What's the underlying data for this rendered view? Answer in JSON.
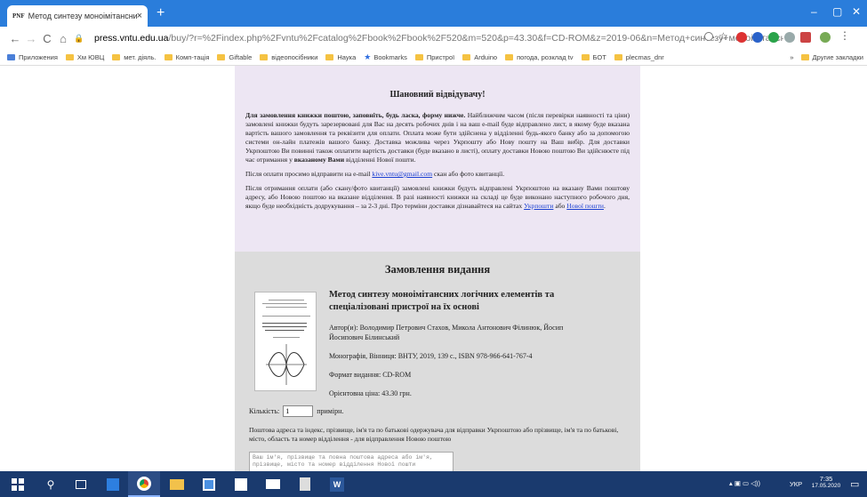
{
  "browser": {
    "tab_favicon": "PNF",
    "tab_title": "Метод синтезу моноімітансних",
    "tab_close": "×",
    "new_tab": "+",
    "minimize": "–",
    "restore": "▢",
    "close": "✕"
  },
  "address": {
    "host": "press.vntu.edu.ua",
    "path": "/buy/?r=%2Findex.php%2Fvntu%2Fcatalog%2Fbook%2Fbook%2F520&m=520&p=43.30&f=CD-ROM&z=2019-06&n=Метод+синтезу+моноімітансних+ло..."
  },
  "bookmarks": {
    "items": [
      {
        "label": "Приложения",
        "icon": "apps-icon"
      },
      {
        "label": "Хм ЮВЦ",
        "icon": "folder-icon"
      },
      {
        "label": "мет. діяль.",
        "icon": "folder-icon"
      },
      {
        "label": "Комп-тація",
        "icon": "folder-icon"
      },
      {
        "label": "Giftable",
        "icon": "folder-icon"
      },
      {
        "label": "відеопосібники",
        "icon": "folder-icon"
      },
      {
        "label": "Наука",
        "icon": "folder-icon"
      },
      {
        "label": "Bookmarks",
        "icon": "star-icon"
      },
      {
        "label": "Пристрої",
        "icon": "folder-icon"
      },
      {
        "label": "Arduino",
        "icon": "folder-icon"
      },
      {
        "label": "погода, розклад tv",
        "icon": "folder-icon"
      },
      {
        "label": "БОТ",
        "icon": "folder-icon"
      },
      {
        "label": "plecmas_dnr",
        "icon": "folder-icon"
      }
    ],
    "more": "»",
    "other": "Другие закладки"
  },
  "notice": {
    "heading": "Шановний відвідувачу!",
    "p1_bold": "Для замовлення книжки поштою, заповніть, будь ласка, форму нижче.",
    "p1_text": " Найближчим часом (після перевірки наявності та ціни) замовлені книжки будуть зарезервовані для Вас на десять робочих днів і на ваш e-mail буде відправлено лист, в якому буде вказана вартість вашого замовлення та реквізити для оплати. Оплата може бути здійснена у відділенні будь-якого банку або за допомогою системи он-лайн платежів вашого банку. Доставка можлива через Укрпошту або Нову пошту на Ваш вибір. Для доставки Укрпоштою Ви повинні також оплатити вартість доставки (буде вказано в листі), оплату доставки Новою поштою Ви здійснюєте під час отримання у ",
    "p1_bold2": "вказаному Вами",
    "p1_end": " відділенні Нової пошти.",
    "p2_pre": "Після оплати просимо відправити на e-mail ",
    "p2_email": "kive.vntu@gmail.com",
    "p2_post": " скан або фото квитанції.",
    "p3": "Після отримання оплати (або скану/фото квитанції) замовлені книжки будуть відправлені Укрпоштою на вказану Вами поштову адресу, або Новою поштою на вказане відділення. В разі наявності книжки на складі це буде виконано наступного робочого дня, якщо буде необхідність додрукування – за 2-3 дні. Про терміни доставки дізнавайтеся на сайтах ",
    "p3_link1": "Укрпошти",
    "p3_mid": " або ",
    "p3_link2": "Нової пошти",
    "p3_end": "."
  },
  "order": {
    "heading": "Замовлення видання",
    "book_title": "Метод синтезу моноімітансних логічних елементів та спеціалізовані пристрої на їх основі",
    "authors": "Автор(и): Володимир Петрович Стахов, Микола Антонович Філинюк, Йосип Йосипович Білинський",
    "publication": "Монографія, Вінниця: ВНТУ, 2019, 139 с., ISBN 978-966-641-767-4",
    "format": "Формат видання: CD-ROM",
    "price": "Орієнтовна ціна: 43.30 грн.",
    "qty_label": "Кількість:",
    "qty_value": "1",
    "qty_unit": "примірн.",
    "address_note": "Поштова адреса та індекс, прізвище, ім'я та по батькові одержувача для відправки Укрпоштою або прізвище, ім'я та по батькові, місто, область та номер відділення - для відправлення Новою поштою",
    "address_placeholder": "Ваш ім'я, прізвище та повна поштова адреса або ім'я, прізвище, місто та номер відділення Нової пошти"
  },
  "taskbar": {
    "lang": "УКР",
    "time": "7:35",
    "date": "17.05.2020"
  }
}
